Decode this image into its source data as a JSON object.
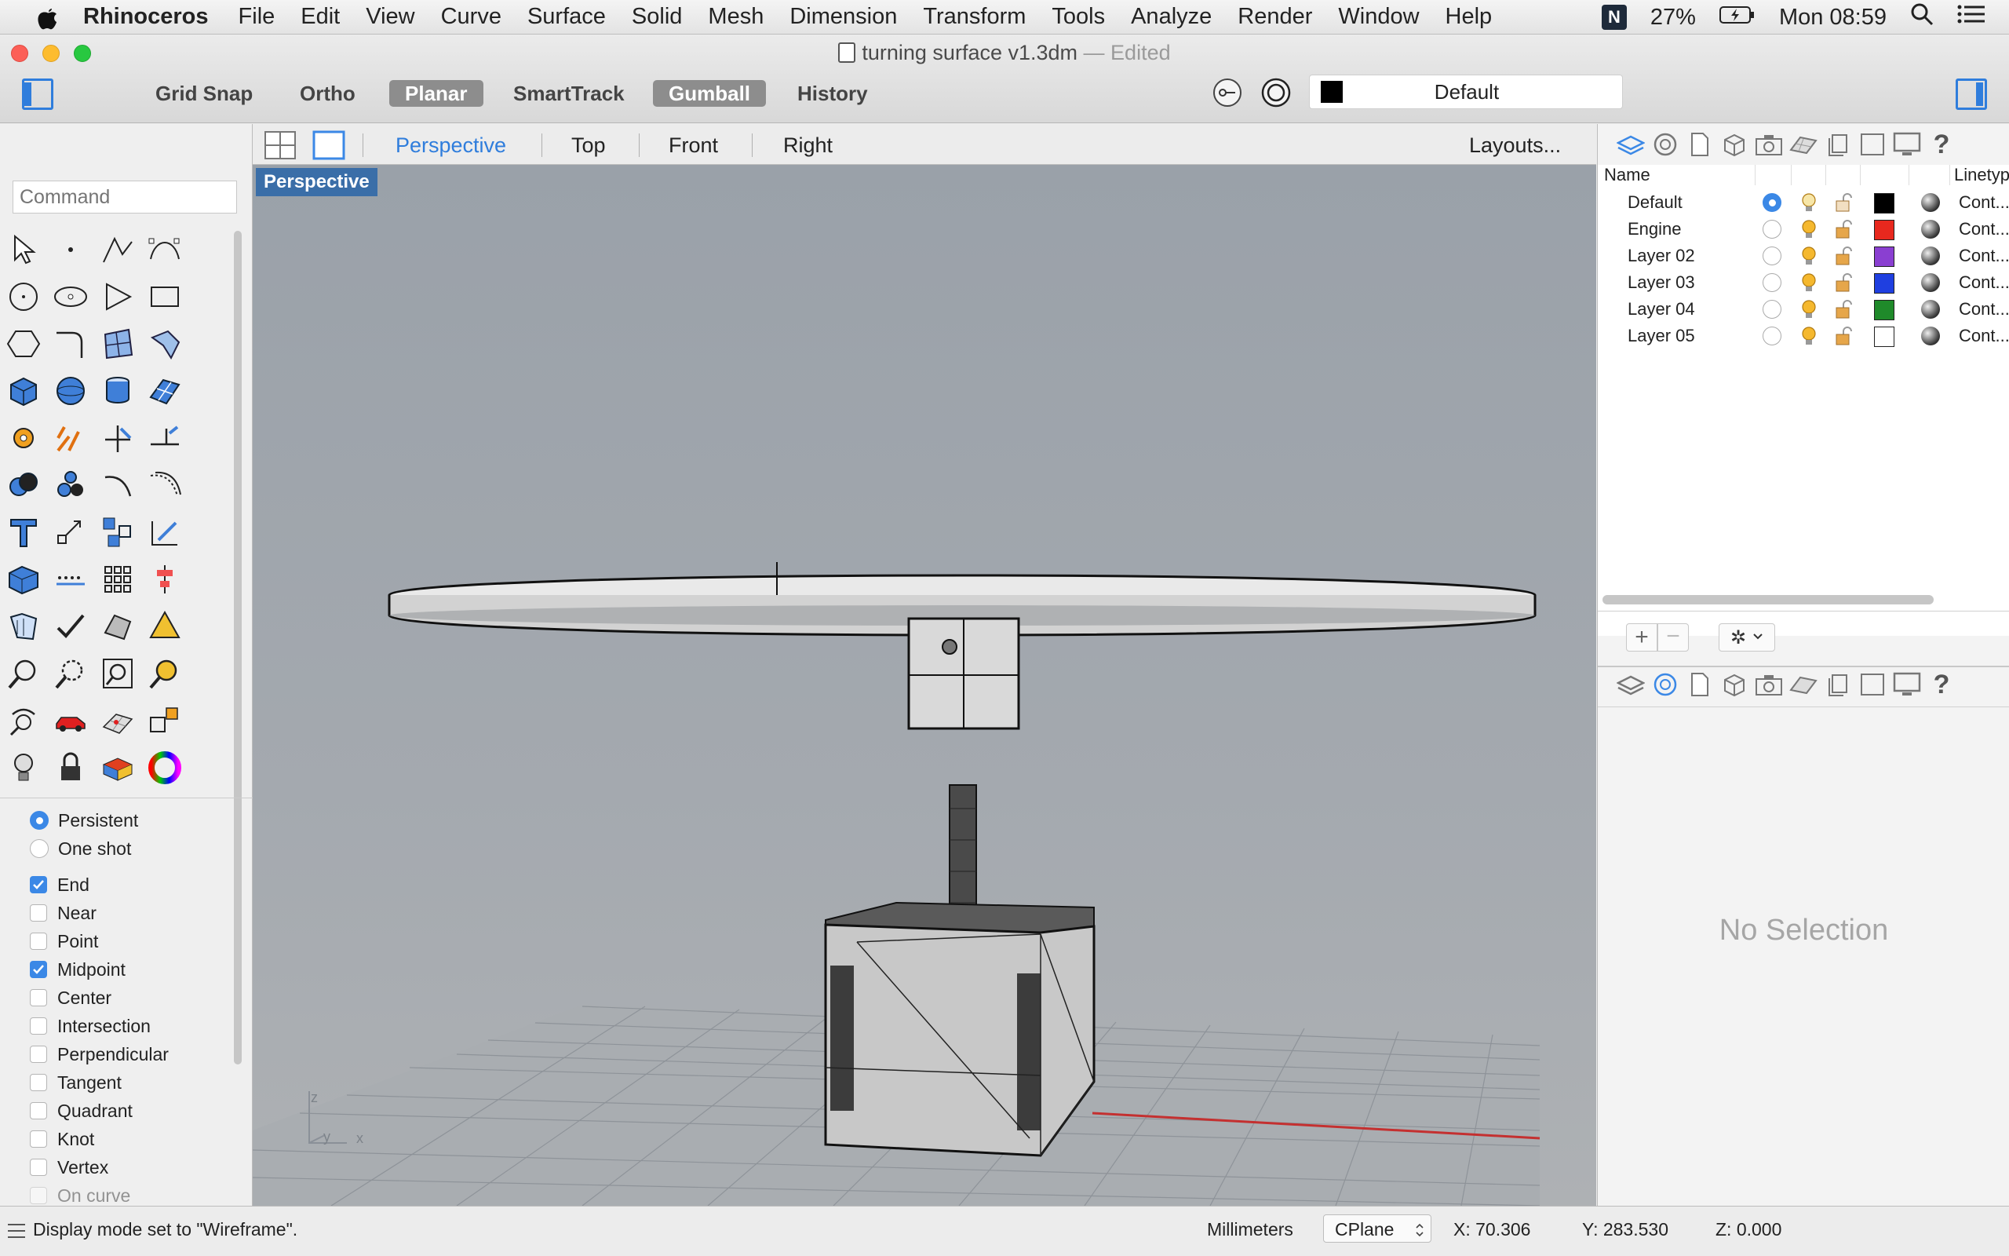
{
  "menubar": {
    "app_name": "Rhinoceros",
    "items": [
      "File",
      "Edit",
      "View",
      "Curve",
      "Surface",
      "Solid",
      "Mesh",
      "Dimension",
      "Transform",
      "Tools",
      "Analyze",
      "Render",
      "Window",
      "Help"
    ],
    "battery": "27%",
    "clock": "Mon 08:59"
  },
  "window": {
    "title": "turning surface v1.3dm",
    "edited_label": "Edited"
  },
  "toolbar": {
    "buttons": [
      {
        "label": "Grid Snap",
        "active": false
      },
      {
        "label": "Ortho",
        "active": false
      },
      {
        "label": "Planar",
        "active": true
      },
      {
        "label": "SmartTrack",
        "active": false
      },
      {
        "label": "Gumball",
        "active": true
      },
      {
        "label": "History",
        "active": false
      }
    ],
    "layer_name": "Default",
    "layer_color": "#000000",
    "accent": "#2f7ddc"
  },
  "command": {
    "placeholder": "Command"
  },
  "osnap": {
    "modes": [
      {
        "label": "Persistent",
        "selected": true
      },
      {
        "label": "One shot",
        "selected": false
      }
    ],
    "snaps": [
      {
        "label": "End",
        "checked": true
      },
      {
        "label": "Near",
        "checked": false
      },
      {
        "label": "Point",
        "checked": false
      },
      {
        "label": "Midpoint",
        "checked": true
      },
      {
        "label": "Center",
        "checked": false
      },
      {
        "label": "Intersection",
        "checked": false
      },
      {
        "label": "Perpendicular",
        "checked": false
      },
      {
        "label": "Tangent",
        "checked": false
      },
      {
        "label": "Quadrant",
        "checked": false
      },
      {
        "label": "Knot",
        "checked": false
      },
      {
        "label": "Vertex",
        "checked": false
      },
      {
        "label": "On curve",
        "checked": false
      }
    ]
  },
  "viewtabs": {
    "tabs": [
      {
        "label": "Perspective",
        "active": true
      },
      {
        "label": "Top",
        "active": false
      },
      {
        "label": "Front",
        "active": false
      },
      {
        "label": "Right",
        "active": false
      }
    ],
    "layouts_label": "Layouts..."
  },
  "viewport": {
    "label": "Perspective",
    "axis_z": "z",
    "axis_y": "y",
    "axis_x": "x"
  },
  "layers": {
    "col_name": "Name",
    "col_linetype": "Linetype",
    "rows": [
      {
        "name": "Default",
        "current": true,
        "color": "#000000",
        "linetype": "Cont..."
      },
      {
        "name": "Engine",
        "current": false,
        "color": "#e8281e",
        "linetype": "Cont..."
      },
      {
        "name": "Layer 02",
        "current": false,
        "color": "#8a3fd1",
        "linetype": "Cont..."
      },
      {
        "name": "Layer 03",
        "current": false,
        "color": "#1f3fe0",
        "linetype": "Cont..."
      },
      {
        "name": "Layer 04",
        "current": false,
        "color": "#1f8a2a",
        "linetype": "Cont..."
      },
      {
        "name": "Layer 05",
        "current": false,
        "color": "#ffffff",
        "linetype": "Cont..."
      }
    ]
  },
  "properties": {
    "empty_text": "No Selection"
  },
  "status": {
    "message": "Display mode set to \"Wireframe\".",
    "units": "Millimeters",
    "cplane": "CPlane",
    "x": "X: 70.306",
    "y": "Y: 283.530",
    "z": "Z: 0.000"
  }
}
